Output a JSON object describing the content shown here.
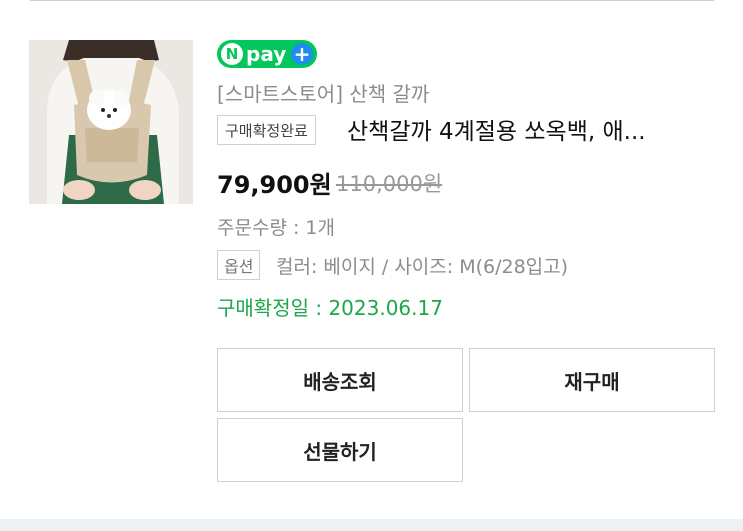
{
  "npay": {
    "n_letter": "N",
    "label": "pay",
    "plus": "+",
    "brand_color": "#03c75a",
    "plus_color": "#1e8cf0"
  },
  "order": {
    "store": "[스마트스토어] 산책 갈까",
    "status_tag": "구매확정완료",
    "title": "산책갈까 4계절용 쏘옥백, 애...",
    "price": "79,900원",
    "original_price": "110,000원",
    "quantity": "주문수량 : 1개",
    "option_label": "옵션",
    "option_value": "컬러: 베이지 / 사이즈: M(6/28입고)",
    "confirm_date": "구매확정일 : 2023.06.17",
    "confirm_color": "#1fa64a"
  },
  "buttons": {
    "track": "배송조회",
    "rebuy": "재구매",
    "gift": "선물하기"
  }
}
